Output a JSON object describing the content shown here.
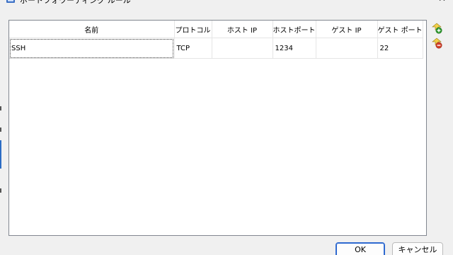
{
  "window": {
    "title": "ポートフォワーディング ルール",
    "close_glyph": "✕"
  },
  "table": {
    "columns": [
      "名前",
      "プロトコル",
      "ホスト IP",
      "ホストポート",
      "ゲスト IP",
      "ゲスト ポート"
    ],
    "rows": [
      {
        "name": "SSH",
        "protocol": "TCP",
        "host_ip": "",
        "host_port": "1234",
        "guest_ip": "",
        "guest_port": "22"
      }
    ]
  },
  "side_buttons": {
    "add_icon": "add-rule-icon",
    "remove_icon": "remove-rule-icon",
    "add_color": "#2e9a2e",
    "remove_color": "#d2402a"
  },
  "buttons": {
    "ok_label": "OK",
    "cancel_label": "キャンセル"
  }
}
